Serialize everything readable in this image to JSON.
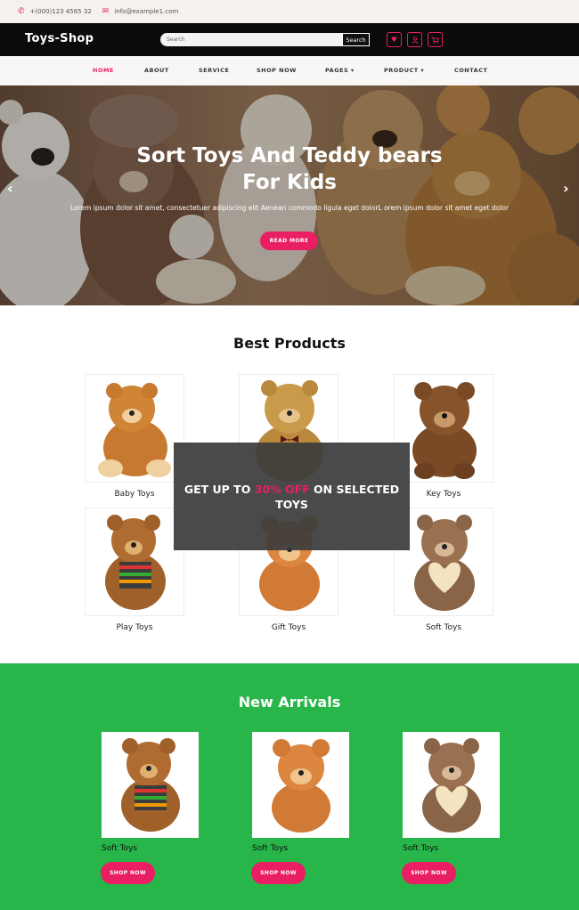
{
  "topbar": {
    "phone_icon": "phone-icon",
    "phone": "+(000)123 4565 32",
    "email_icon": "mail-icon",
    "email": "info@example1.com"
  },
  "header": {
    "brand": "Toys-Shop",
    "search_placeholder": "Search",
    "search_button": "Search",
    "icons": [
      "heart-icon",
      "user-icon",
      "cart-icon"
    ]
  },
  "nav": {
    "items": [
      "HOME",
      "ABOUT",
      "SERVICE",
      "SHOP NOW",
      "PAGES ▾",
      "PRODUCT ▾",
      "CONTACT"
    ],
    "active": "HOME"
  },
  "hero": {
    "title_line1": "Sort Toys And Teddy bears",
    "title_line2": "For Kids",
    "text": "Lorem ipsum dolor sit amet, consectetuer adipiscing elit Aenean commodo ligula eget dolorL orem ipsum dolor sit amet eget dolor",
    "button": "READ MORE",
    "prev": "‹",
    "next": "›"
  },
  "best_products": {
    "title": "Best Products",
    "items": [
      "Baby Toys",
      "",
      "Key Toys",
      "Play Toys",
      "Gift Toys",
      "Soft Toys"
    ]
  },
  "promo": {
    "prefix": "GET UP TO ",
    "highlight": "30% OFF",
    "suffix": " ON SELECTED",
    "line2": "TOYS"
  },
  "new_arrivals": {
    "title": "New Arrivals",
    "items": [
      {
        "label": "Soft Toys",
        "button": "SHOP NOW"
      },
      {
        "label": "Soft Toys",
        "button": "SHOP NOW"
      },
      {
        "label": "Soft Toys",
        "button": "SHOP NOW"
      }
    ]
  },
  "colors": {
    "accent": "#e91e63",
    "header_bg": "#0b0b0b",
    "arrivals_bg": "#28b54a"
  }
}
